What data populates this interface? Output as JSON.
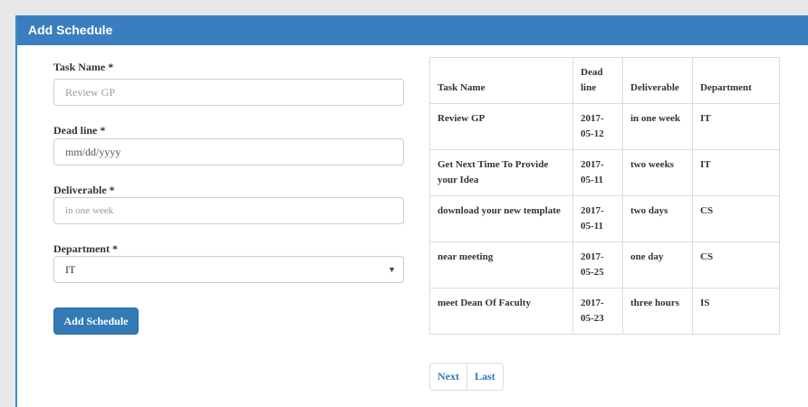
{
  "panel": {
    "title": "Add Schedule"
  },
  "form": {
    "task_name": {
      "label": "Task Name *",
      "placeholder": "Review GP"
    },
    "deadline": {
      "label": "Dead line *",
      "value": "mm/dd/yyyy"
    },
    "deliverable": {
      "label": "Deliverable *",
      "placeholder": "in one week"
    },
    "department": {
      "label": "Department *",
      "selected": "IT"
    },
    "submit_label": "Add Schedule"
  },
  "table": {
    "headers": [
      "Task Name",
      "Dead line",
      "Deliverable",
      "Department"
    ],
    "rows": [
      [
        "Review GP",
        "2017-05-12",
        "in one week",
        "IT"
      ],
      [
        "Get Next Time To Provide your Idea",
        "2017-05-11",
        "two weeks",
        "IT"
      ],
      [
        "download your new template",
        "2017-05-11",
        "two days",
        "CS"
      ],
      [
        "near meeting",
        "2017-05-25",
        "one day",
        "CS"
      ],
      [
        "meet Dean Of Faculty",
        "2017-05-23",
        "three hours",
        "IS"
      ]
    ]
  },
  "pagination": {
    "next": "Next",
    "last": "Last"
  },
  "colors": {
    "primary": "#337ab7",
    "heading": "#3a7ebf"
  }
}
